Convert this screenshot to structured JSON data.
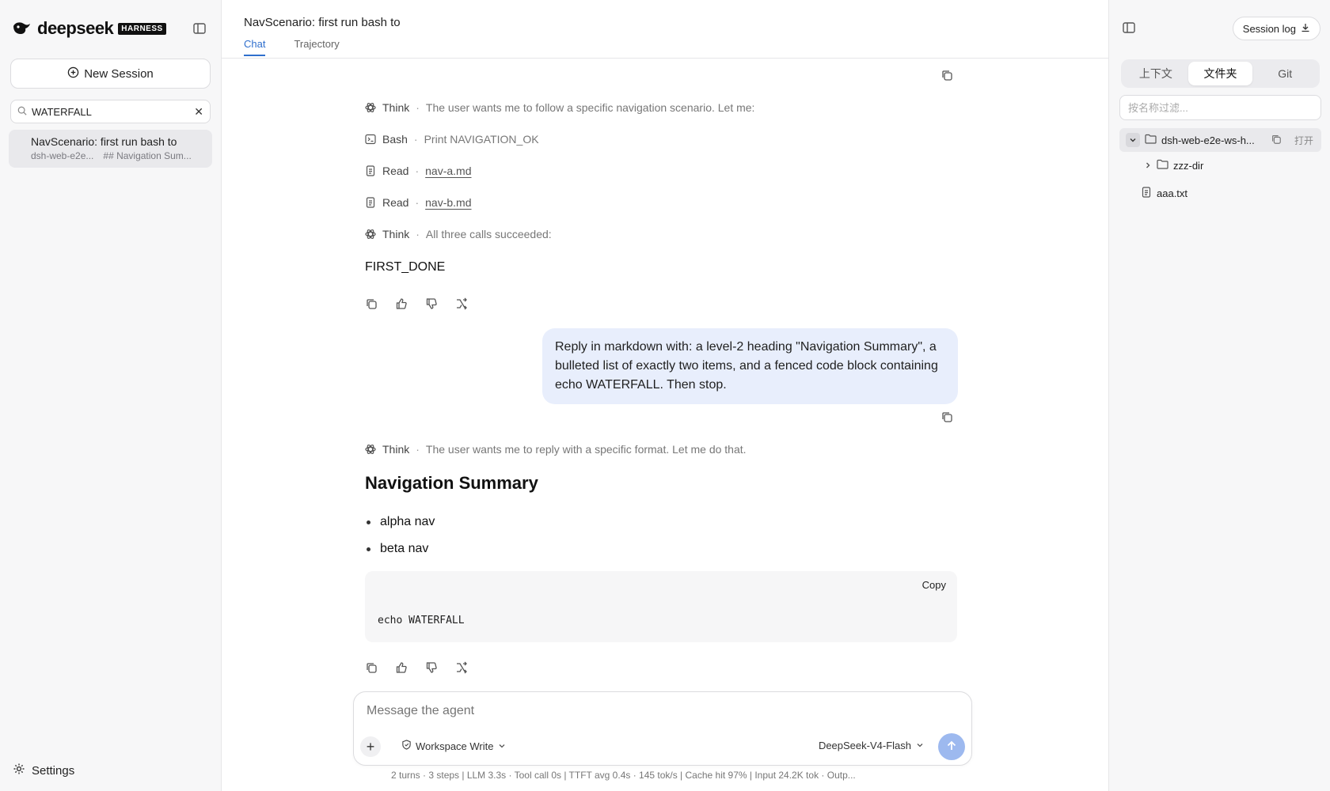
{
  "brand": {
    "name": "deepseek",
    "badge": "HARNESS"
  },
  "sidebar": {
    "new_session": "New Session",
    "search": {
      "value": "WATERFALL"
    },
    "sessions": [
      {
        "title": "NavScenario: first run bash to",
        "workspace": "dsh-web-e2e...",
        "preview": "## Navigation Sum..."
      }
    ],
    "settings": "Settings"
  },
  "header": {
    "title": "NavScenario: first run bash to",
    "tabs": [
      {
        "label": "Chat"
      },
      {
        "label": "Trajectory"
      }
    ]
  },
  "chat": {
    "turn1": {
      "steps": [
        {
          "kind": "Think",
          "detail": "The user wants me to follow a specific navigation scenario. Let me:"
        },
        {
          "kind": "Bash",
          "detail": "Print NAVIGATION_OK"
        },
        {
          "kind": "Read",
          "detail": "nav-a.md"
        },
        {
          "kind": "Read",
          "detail": "nav-b.md"
        },
        {
          "kind": "Think",
          "detail": "All three calls succeeded:"
        }
      ],
      "answer": "FIRST_DONE"
    },
    "user_message": "Reply in markdown with: a level-2 heading \"Navigation Summary\", a bulleted list of exactly two items, and a fenced code block containing echo WATERFALL. Then stop.",
    "turn2": {
      "think": {
        "kind": "Think",
        "detail": "The user wants me to reply with a specific format. Let me do that."
      },
      "heading": "Navigation Summary",
      "bullets": [
        "alpha nav",
        "beta nav"
      ],
      "code": {
        "copy_label": "Copy",
        "text": "echo WATERFALL"
      }
    },
    "separator": "·"
  },
  "composer": {
    "placeholder": "Message the agent",
    "mode": "Workspace Write",
    "model": "DeepSeek-V4-Flash"
  },
  "status_bar": "2 turns · 3 steps  |  LLM 3.3s · Tool call 0s  |  TTFT avg 0.4s · 145 tok/s  |  Cache hit 97%  |  Input 24.2K tok · Outp...",
  "right_panel": {
    "session_log": "Session log",
    "tabs": [
      {
        "label": "上下文"
      },
      {
        "label": "文件夹"
      },
      {
        "label": "Git"
      }
    ],
    "filter_placeholder": "按名称过滤...",
    "tree": {
      "root": "dsh-web-e2e-ws-h...",
      "open_label": "打开",
      "children": [
        {
          "name": "zzz-dir",
          "type": "folder"
        },
        {
          "name": "aaa.txt",
          "type": "file"
        }
      ]
    }
  },
  "colors": {
    "accent": "#2f6fcd",
    "user_bubble": "#e8eefc",
    "send": "#9db9ef"
  },
  "icons": [
    "whale-logo-icon",
    "sidebar-toggle-icon",
    "plus-circle-icon",
    "search-icon",
    "close-icon",
    "gear-icon",
    "copy-icon",
    "think-icon",
    "terminal-icon",
    "file-icon",
    "thumbs-up-icon",
    "thumbs-down-icon",
    "branch-icon",
    "shield-icon",
    "chevron-down-icon",
    "arrow-up-icon",
    "download-icon",
    "folder-icon",
    "chevron-right-icon"
  ]
}
